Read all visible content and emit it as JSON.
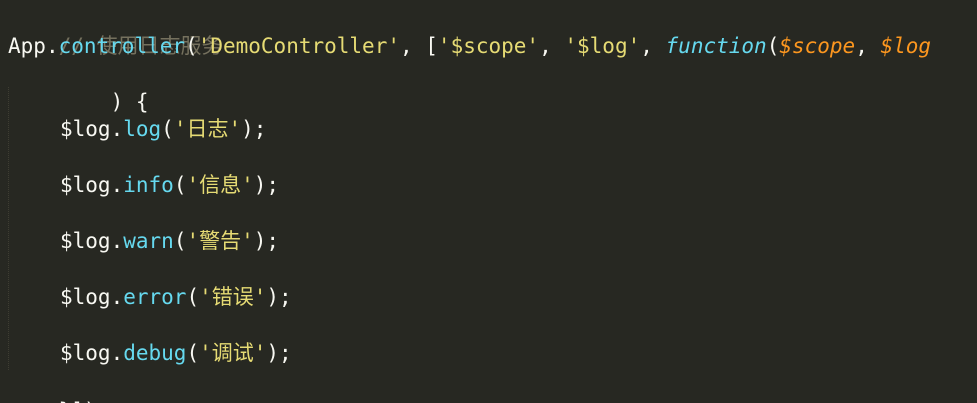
{
  "colors": {
    "background": "#272822",
    "text": "#f8f8f2",
    "comment": "#75715e",
    "string": "#e6db74",
    "function": "#66d9ef",
    "parameter": "#fd971f"
  },
  "code": {
    "comment": "// 使用日志服务",
    "decl": {
      "obj": "App",
      "dot": ".",
      "method": "controller",
      "open": "(",
      "name": "'DemoController'",
      "sep1": ", [",
      "dep1": "'$scope'",
      "sep2": ", ",
      "dep2": "'$log'",
      "sep3": ", ",
      "keyword": "function",
      "paren": "(",
      "param1": "$scope",
      "sep4": ", ",
      "param2": "$log",
      "wrap": ") {"
    },
    "calls": [
      {
        "obj": "$log",
        "dot": ".",
        "method": "log",
        "open": "(",
        "arg": "'日志'",
        "close": ");"
      },
      {
        "obj": "$log",
        "dot": ".",
        "method": "info",
        "open": "(",
        "arg": "'信息'",
        "close": ");"
      },
      {
        "obj": "$log",
        "dot": ".",
        "method": "warn",
        "open": "(",
        "arg": "'警告'",
        "close": ");"
      },
      {
        "obj": "$log",
        "dot": ".",
        "method": "error",
        "open": "(",
        "arg": "'错误'",
        "close": ");"
      },
      {
        "obj": "$log",
        "dot": ".",
        "method": "debug",
        "open": "(",
        "arg": "'调试'",
        "close": ");"
      }
    ],
    "closing": "}]);"
  }
}
